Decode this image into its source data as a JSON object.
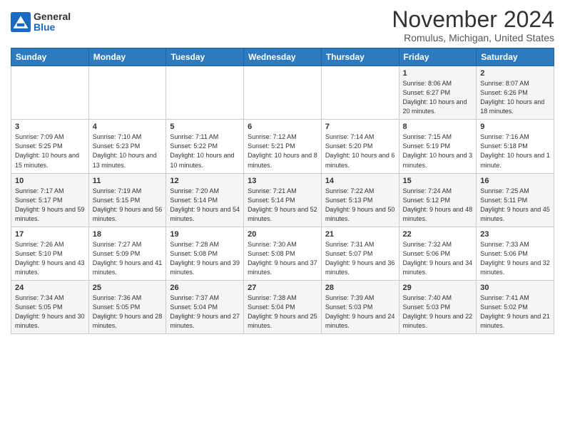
{
  "header": {
    "logo": {
      "general": "General",
      "blue": "Blue"
    },
    "title": "November 2024",
    "location": "Romulus, Michigan, United States"
  },
  "weekdays": [
    "Sunday",
    "Monday",
    "Tuesday",
    "Wednesday",
    "Thursday",
    "Friday",
    "Saturday"
  ],
  "weeks": [
    [
      {
        "day": "",
        "info": ""
      },
      {
        "day": "",
        "info": ""
      },
      {
        "day": "",
        "info": ""
      },
      {
        "day": "",
        "info": ""
      },
      {
        "day": "",
        "info": ""
      },
      {
        "day": "1",
        "info": "Sunrise: 8:06 AM\nSunset: 6:27 PM\nDaylight: 10 hours and 20 minutes."
      },
      {
        "day": "2",
        "info": "Sunrise: 8:07 AM\nSunset: 6:26 PM\nDaylight: 10 hours and 18 minutes."
      }
    ],
    [
      {
        "day": "3",
        "info": "Sunrise: 7:09 AM\nSunset: 5:25 PM\nDaylight: 10 hours and 15 minutes."
      },
      {
        "day": "4",
        "info": "Sunrise: 7:10 AM\nSunset: 5:23 PM\nDaylight: 10 hours and 13 minutes."
      },
      {
        "day": "5",
        "info": "Sunrise: 7:11 AM\nSunset: 5:22 PM\nDaylight: 10 hours and 10 minutes."
      },
      {
        "day": "6",
        "info": "Sunrise: 7:12 AM\nSunset: 5:21 PM\nDaylight: 10 hours and 8 minutes."
      },
      {
        "day": "7",
        "info": "Sunrise: 7:14 AM\nSunset: 5:20 PM\nDaylight: 10 hours and 6 minutes."
      },
      {
        "day": "8",
        "info": "Sunrise: 7:15 AM\nSunset: 5:19 PM\nDaylight: 10 hours and 3 minutes."
      },
      {
        "day": "9",
        "info": "Sunrise: 7:16 AM\nSunset: 5:18 PM\nDaylight: 10 hours and 1 minute."
      }
    ],
    [
      {
        "day": "10",
        "info": "Sunrise: 7:17 AM\nSunset: 5:17 PM\nDaylight: 9 hours and 59 minutes."
      },
      {
        "day": "11",
        "info": "Sunrise: 7:19 AM\nSunset: 5:15 PM\nDaylight: 9 hours and 56 minutes."
      },
      {
        "day": "12",
        "info": "Sunrise: 7:20 AM\nSunset: 5:14 PM\nDaylight: 9 hours and 54 minutes."
      },
      {
        "day": "13",
        "info": "Sunrise: 7:21 AM\nSunset: 5:14 PM\nDaylight: 9 hours and 52 minutes."
      },
      {
        "day": "14",
        "info": "Sunrise: 7:22 AM\nSunset: 5:13 PM\nDaylight: 9 hours and 50 minutes."
      },
      {
        "day": "15",
        "info": "Sunrise: 7:24 AM\nSunset: 5:12 PM\nDaylight: 9 hours and 48 minutes."
      },
      {
        "day": "16",
        "info": "Sunrise: 7:25 AM\nSunset: 5:11 PM\nDaylight: 9 hours and 45 minutes."
      }
    ],
    [
      {
        "day": "17",
        "info": "Sunrise: 7:26 AM\nSunset: 5:10 PM\nDaylight: 9 hours and 43 minutes."
      },
      {
        "day": "18",
        "info": "Sunrise: 7:27 AM\nSunset: 5:09 PM\nDaylight: 9 hours and 41 minutes."
      },
      {
        "day": "19",
        "info": "Sunrise: 7:28 AM\nSunset: 5:08 PM\nDaylight: 9 hours and 39 minutes."
      },
      {
        "day": "20",
        "info": "Sunrise: 7:30 AM\nSunset: 5:08 PM\nDaylight: 9 hours and 37 minutes."
      },
      {
        "day": "21",
        "info": "Sunrise: 7:31 AM\nSunset: 5:07 PM\nDaylight: 9 hours and 36 minutes."
      },
      {
        "day": "22",
        "info": "Sunrise: 7:32 AM\nSunset: 5:06 PM\nDaylight: 9 hours and 34 minutes."
      },
      {
        "day": "23",
        "info": "Sunrise: 7:33 AM\nSunset: 5:06 PM\nDaylight: 9 hours and 32 minutes."
      }
    ],
    [
      {
        "day": "24",
        "info": "Sunrise: 7:34 AM\nSunset: 5:05 PM\nDaylight: 9 hours and 30 minutes."
      },
      {
        "day": "25",
        "info": "Sunrise: 7:36 AM\nSunset: 5:05 PM\nDaylight: 9 hours and 28 minutes."
      },
      {
        "day": "26",
        "info": "Sunrise: 7:37 AM\nSunset: 5:04 PM\nDaylight: 9 hours and 27 minutes."
      },
      {
        "day": "27",
        "info": "Sunrise: 7:38 AM\nSunset: 5:04 PM\nDaylight: 9 hours and 25 minutes."
      },
      {
        "day": "28",
        "info": "Sunrise: 7:39 AM\nSunset: 5:03 PM\nDaylight: 9 hours and 24 minutes."
      },
      {
        "day": "29",
        "info": "Sunrise: 7:40 AM\nSunset: 5:03 PM\nDaylight: 9 hours and 22 minutes."
      },
      {
        "day": "30",
        "info": "Sunrise: 7:41 AM\nSunset: 5:02 PM\nDaylight: 9 hours and 21 minutes."
      }
    ]
  ]
}
